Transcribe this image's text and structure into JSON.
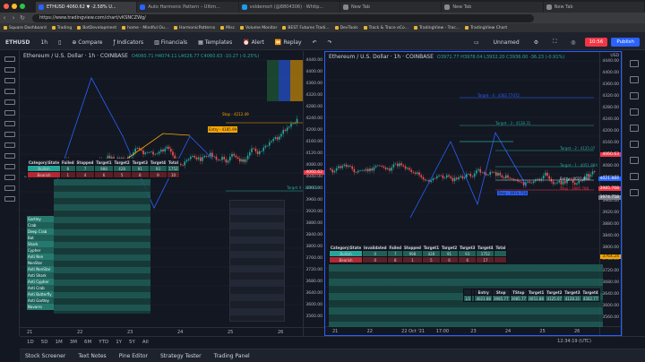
{
  "browser": {
    "tabs": [
      {
        "label": "ETHUSD 4060.62 ▼ -2.58% U...",
        "active": true
      },
      {
        "label": "Auto Harmonic Pattern – Ultim...",
        "active": false
      },
      {
        "label": "voldemort (@8804306) · Whitp...",
        "active": false
      },
      {
        "label": "New Tab",
        "active": false
      },
      {
        "label": "New Tab",
        "active": false
      },
      {
        "label": "New Tab",
        "active": false
      }
    ],
    "url": "https://www.tradingview.com/chart/vKSNCZWg/",
    "bookmarks": [
      "Square Dashboard",
      "Trading",
      "BotDevelopment",
      "home - Mindful Ou...",
      "HarmonicPatterns",
      "Misc",
      "Volume Monitor",
      "BEST Futures Tradi...",
      "DevTools",
      "Track & Trace eCo...",
      "TradingView - Trac...",
      "TradingView Chart"
    ]
  },
  "toolbar": {
    "symbol": "ETHUSD",
    "interval": "1h",
    "compare": "Compare",
    "indicators": "Indicators",
    "financials": "Financials",
    "templates": "Templates",
    "alert": "Alert",
    "replay": "Replay",
    "layout_name": "Unnamed",
    "timer": "10:56",
    "publish": "Publish"
  },
  "pane1": {
    "title": "Ethereum / U.S. Dollar · 1h · COINBASE",
    "ohlc": "O4060.71 H4074.11 L4026.77 C4060.63 -10.27 (-0.25%)",
    "price_labels": [
      "4440.00",
      "4400.00",
      "4360.00",
      "4320.00",
      "4280.00",
      "4240.00",
      "4200.00",
      "4160.00",
      "4120.00",
      "4080.00",
      "4040.00",
      "4000.00",
      "3960.00",
      "3920.00",
      "3880.00",
      "3840.00",
      "3800.00",
      "3760.00",
      "3720.00",
      "3680.00",
      "3640.00",
      "3600.00",
      "3560.00"
    ],
    "x_labels": [
      "21",
      "22",
      "23",
      "24",
      "25",
      "26"
    ],
    "last_price": "4060.62",
    "table_header": [
      "Category\\State",
      "Failed",
      "Stopped",
      "Target1",
      "Target2",
      "Target3",
      "Target4",
      "Total"
    ],
    "table_rows": [
      [
        "Bullish",
        "8",
        "7",
        "988",
        "428",
        "91",
        "93",
        "1752"
      ],
      [
        "Bearish",
        "1",
        "4",
        "6",
        "5",
        "8",
        "9",
        "10"
      ]
    ],
    "patterns": [
      "Gartley",
      "Crab",
      "Deep Crab",
      "Bat",
      "Shark",
      "Cypher",
      "Anti Nen",
      "NenStar",
      "Anti NenStar",
      "Anti Shark",
      "Anti Cypher",
      "Anti Crab",
      "Anti Butterfly",
      "Anti Gartley",
      "Navarro"
    ],
    "annotations": {
      "stop": "Stop - 4212.49",
      "entry": "Entry - 4185.99",
      "target": "Target 4 - 3993.58"
    }
  },
  "pane2": {
    "title": "Ethereum / U.S. Dollar · 1h · COINBASE",
    "ohlc": "O3971.77 H3978.04 L3932.20 C3936.00 -36.23 (-0.91%)",
    "price_labels": [
      "4440.00",
      "4400.00",
      "4360.00",
      "4320.00",
      "4280.00",
      "4240.00",
      "4200.00",
      "4160.00",
      "4120.00",
      "4080.00",
      "4040.00",
      "4000.00",
      "3960.00",
      "3920.00",
      "3880.00",
      "3840.00",
      "3800.00",
      "3760.00",
      "3720.00",
      "3680.00",
      "3640.00",
      "3600.00",
      "3560.00"
    ],
    "x_labels": [
      "21",
      "22",
      "22 Oct '21",
      "17:00",
      "23",
      "24",
      "25",
      "26"
    ],
    "usd_label": "USD",
    "annotations": {
      "target4": "Target - 4 : 4302.77472",
      "target3": "Target - 3 : 4128.31",
      "target2": "Target - 2 : 4125.07",
      "stop": "Stop : 3974.758",
      "entry": "Entry : 4021.884",
      "stop2": "Stop : 3985.768",
      "target1": "Target - 1 : 4051.884"
    },
    "price_tags": [
      "4060.63",
      "4021.884",
      "3985.768",
      "3974.758",
      "3764.24"
    ],
    "table_header": [
      "Category\\State",
      "Invalidated",
      "Failed",
      "Stopped",
      "Target1",
      "Target2",
      "Target3",
      "Target4",
      "Total"
    ],
    "table_rows": [
      [
        "Bullish",
        "0",
        "7",
        "998",
        "428",
        "91",
        "93",
        "1752"
      ],
      [
        "Bearish",
        "0",
        "8",
        "1",
        "5",
        "6",
        "6",
        "17"
      ]
    ],
    "stats_header": [
      "",
      "",
      "Entry",
      "Stop",
      "TStop",
      "Target1",
      "Target2",
      "Target3",
      "Target4"
    ],
    "stats_rows": [
      [
        "1/2",
        "",
        "4021.88",
        "3985.77",
        "3985.77",
        "4051.88",
        "4125.07",
        "4128.31",
        "4302.77"
      ]
    ]
  },
  "ranges": [
    "1D",
    "5D",
    "1M",
    "3M",
    "6M",
    "YTD",
    "1Y",
    "5Y",
    "All"
  ],
  "clock": "12:34:19 (UTC)",
  "bottom_tabs": [
    "Stock Screener",
    "Text Notes",
    "Pine Editor",
    "Strategy Tester",
    "Trading Panel"
  ]
}
